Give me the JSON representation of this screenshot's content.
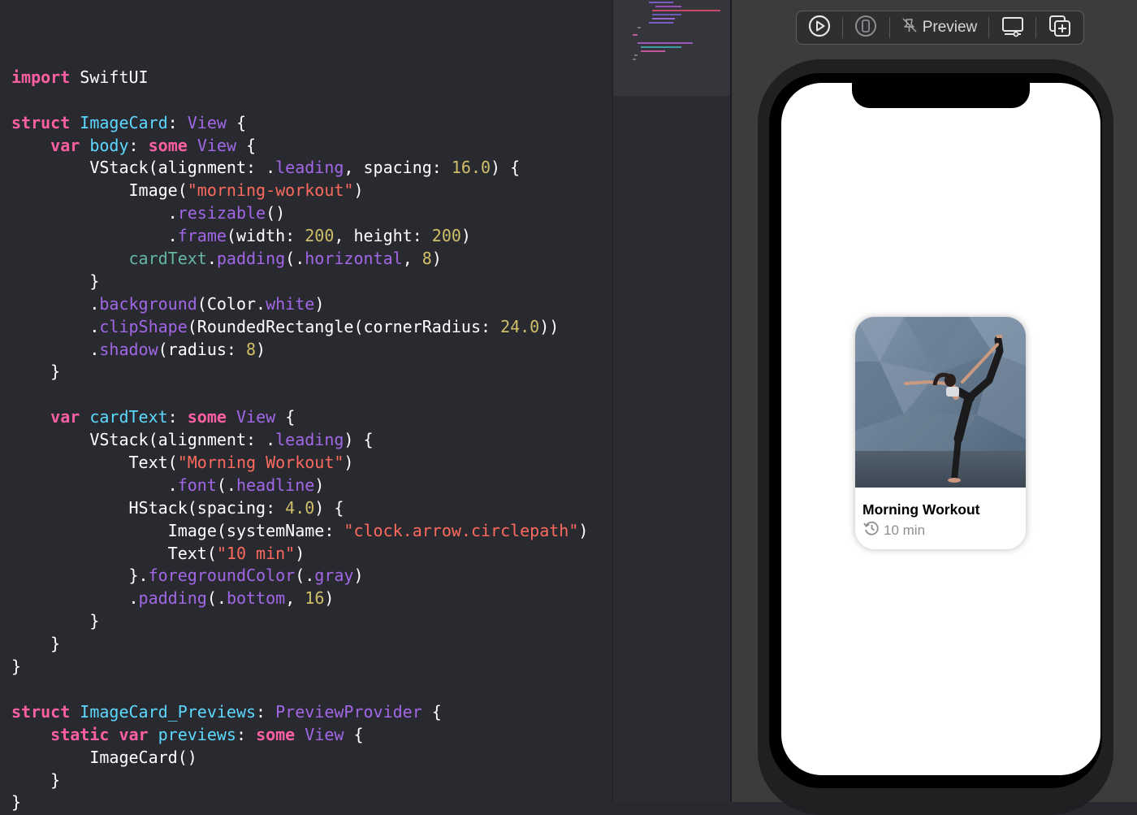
{
  "editor": {
    "code_lines": [
      [],
      [
        {
          "t": "import",
          "c": "kw"
        },
        {
          "t": " SwiftUI"
        }
      ],
      [],
      [
        {
          "t": "struct",
          "c": "kw"
        },
        {
          "t": " "
        },
        {
          "t": "ImageCard",
          "c": "ty"
        },
        {
          "t": ": "
        },
        {
          "t": "View",
          "c": "pl"
        },
        {
          "t": " {"
        }
      ],
      [
        {
          "t": "    "
        },
        {
          "t": "var",
          "c": "kw"
        },
        {
          "t": " "
        },
        {
          "t": "body",
          "c": "ty"
        },
        {
          "t": ": "
        },
        {
          "t": "some",
          "c": "kw"
        },
        {
          "t": " "
        },
        {
          "t": "View",
          "c": "pl"
        },
        {
          "t": " {"
        }
      ],
      [
        {
          "t": "        VStack(alignment: ."
        },
        {
          "t": "leading",
          "c": "pl"
        },
        {
          "t": ", spacing: "
        },
        {
          "t": "16.0",
          "c": "nu"
        },
        {
          "t": ") {"
        }
      ],
      [
        {
          "t": "            Image("
        },
        {
          "t": "\"morning-workout\"",
          "c": "st"
        },
        {
          "t": ")"
        }
      ],
      [
        {
          "t": "                ."
        },
        {
          "t": "resizable",
          "c": "pl"
        },
        {
          "t": "()"
        }
      ],
      [
        {
          "t": "                ."
        },
        {
          "t": "frame",
          "c": "pl"
        },
        {
          "t": "(width: "
        },
        {
          "t": "200",
          "c": "nu"
        },
        {
          "t": ", height: "
        },
        {
          "t": "200",
          "c": "nu"
        },
        {
          "t": ")"
        }
      ],
      [
        {
          "t": "            "
        },
        {
          "t": "cardText",
          "c": "gr"
        },
        {
          "t": "."
        },
        {
          "t": "padding",
          "c": "pl"
        },
        {
          "t": "(."
        },
        {
          "t": "horizontal",
          "c": "pl"
        },
        {
          "t": ", "
        },
        {
          "t": "8",
          "c": "nu"
        },
        {
          "t": ")"
        }
      ],
      [
        {
          "t": "        }"
        }
      ],
      [
        {
          "t": "        ."
        },
        {
          "t": "background",
          "c": "pl"
        },
        {
          "t": "(Color."
        },
        {
          "t": "white",
          "c": "pl"
        },
        {
          "t": ")"
        }
      ],
      [
        {
          "t": "        ."
        },
        {
          "t": "clipShape",
          "c": "pl"
        },
        {
          "t": "(RoundedRectangle(cornerRadius: "
        },
        {
          "t": "24.0",
          "c": "nu"
        },
        {
          "t": "))"
        }
      ],
      [
        {
          "t": "        ."
        },
        {
          "t": "shadow",
          "c": "pl"
        },
        {
          "t": "(radius: "
        },
        {
          "t": "8",
          "c": "nu"
        },
        {
          "t": ")"
        }
      ],
      [
        {
          "t": "    }"
        }
      ],
      [],
      [
        {
          "t": "    "
        },
        {
          "t": "var",
          "c": "kw"
        },
        {
          "t": " "
        },
        {
          "t": "cardText",
          "c": "ty"
        },
        {
          "t": ": "
        },
        {
          "t": "some",
          "c": "kw"
        },
        {
          "t": " "
        },
        {
          "t": "View",
          "c": "pl"
        },
        {
          "t": " {"
        }
      ],
      [
        {
          "t": "        VStack(alignment: ."
        },
        {
          "t": "leading",
          "c": "pl"
        },
        {
          "t": ") {"
        }
      ],
      [
        {
          "t": "            Text("
        },
        {
          "t": "\"Morning Workout\"",
          "c": "st"
        },
        {
          "t": ")"
        }
      ],
      [
        {
          "t": "                ."
        },
        {
          "t": "font",
          "c": "pl"
        },
        {
          "t": "(."
        },
        {
          "t": "headline",
          "c": "pl"
        },
        {
          "t": ")"
        }
      ],
      [
        {
          "t": "            HStack(spacing: "
        },
        {
          "t": "4.0",
          "c": "nu"
        },
        {
          "t": ") {"
        }
      ],
      [
        {
          "t": "                Image(systemName: "
        },
        {
          "t": "\"clock.arrow.circlepath\"",
          "c": "st"
        },
        {
          "t": ")"
        }
      ],
      [
        {
          "t": "                Text("
        },
        {
          "t": "\"10 min\"",
          "c": "st"
        },
        {
          "t": ")"
        }
      ],
      [
        {
          "t": "            }."
        },
        {
          "t": "foregroundColor",
          "c": "pl"
        },
        {
          "t": "(."
        },
        {
          "t": "gray",
          "c": "pl"
        },
        {
          "t": ")"
        }
      ],
      [
        {
          "t": "            ."
        },
        {
          "t": "padding",
          "c": "pl"
        },
        {
          "t": "(."
        },
        {
          "t": "bottom",
          "c": "pl"
        },
        {
          "t": ", "
        },
        {
          "t": "16",
          "c": "nu"
        },
        {
          "t": ")"
        }
      ],
      [
        {
          "t": "        }"
        }
      ],
      [
        {
          "t": "    }"
        }
      ],
      [
        {
          "t": "}"
        }
      ],
      [],
      [
        {
          "t": "struct",
          "c": "kw"
        },
        {
          "t": " "
        },
        {
          "t": "ImageCard_Previews",
          "c": "ty"
        },
        {
          "t": ": "
        },
        {
          "t": "PreviewProvider",
          "c": "pl"
        },
        {
          "t": " {"
        }
      ],
      [
        {
          "t": "    "
        },
        {
          "t": "static",
          "c": "kw"
        },
        {
          "t": " "
        },
        {
          "t": "var",
          "c": "kw"
        },
        {
          "t": " "
        },
        {
          "t": "previews",
          "c": "ty"
        },
        {
          "t": ": "
        },
        {
          "t": "some",
          "c": "kw"
        },
        {
          "t": " "
        },
        {
          "t": "View",
          "c": "pl"
        },
        {
          "t": " {"
        }
      ],
      [
        {
          "t": "        ImageCard()"
        }
      ],
      [
        {
          "t": "    }"
        }
      ],
      [
        {
          "t": "}"
        }
      ]
    ]
  },
  "preview_toolbar": {
    "live_preview_icon": "play-circle-icon",
    "device_icon": "iphone-icon",
    "pin_icon": "pin-slash-icon",
    "preview_label": "Preview",
    "device_settings_icon": "display-settings-icon",
    "duplicate_icon": "plus-square-on-square-icon"
  },
  "card": {
    "image_icon": "yoga-photo",
    "title": "Morning Workout",
    "meta_icon": "clock-arrow-circlepath-icon",
    "duration": "10 min"
  },
  "colors": {
    "editor_bg": "#292a30",
    "keyword": "#fc5fa3",
    "type": "#5dd8ff",
    "other_decl": "#a167e6",
    "project_decl": "#67b7a4",
    "string": "#fc6a5d",
    "number": "#d0bf69",
    "canvas_bg": "#3c3c3d"
  }
}
